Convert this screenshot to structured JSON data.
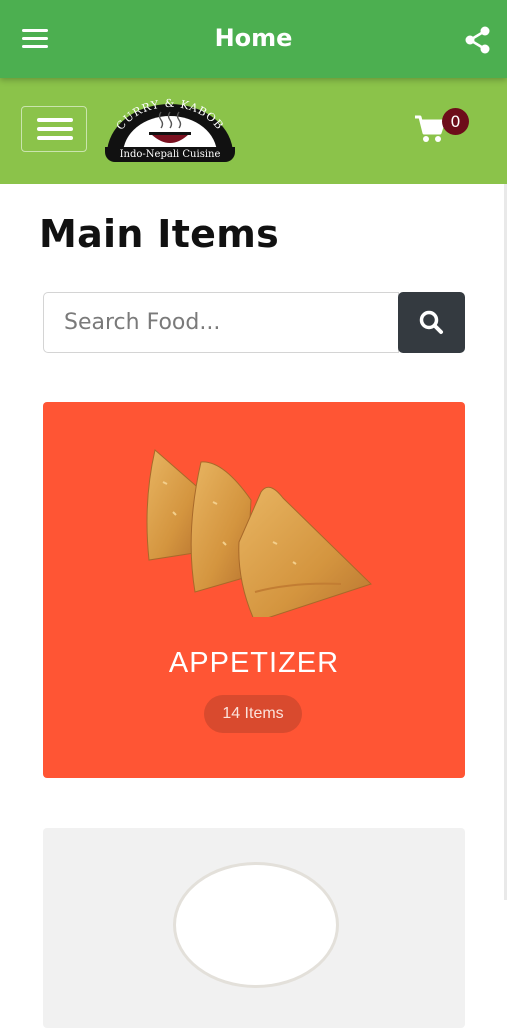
{
  "app_bar": {
    "title": "Home",
    "menu_icon": "menu-icon",
    "share_icon": "share-icon",
    "background": "#4caf50"
  },
  "header": {
    "logo": {
      "top_text": "CURRY & KABOB",
      "tagline": "Indo-Nepali Cuisine"
    },
    "cart_icon": "cart-icon",
    "cart_count": "0",
    "background": "#8bc34a"
  },
  "main": {
    "title": "Main Items",
    "search": {
      "placeholder": "Search Food...",
      "value": "",
      "button_icon": "search-icon"
    },
    "categories": [
      {
        "name": "APPETIZER",
        "count": "14 Items",
        "color": "#ff5534",
        "image": "samosa-image"
      },
      {
        "name": "",
        "count": "",
        "color": "#f1f1f1",
        "image": "dumplings-image"
      }
    ]
  }
}
